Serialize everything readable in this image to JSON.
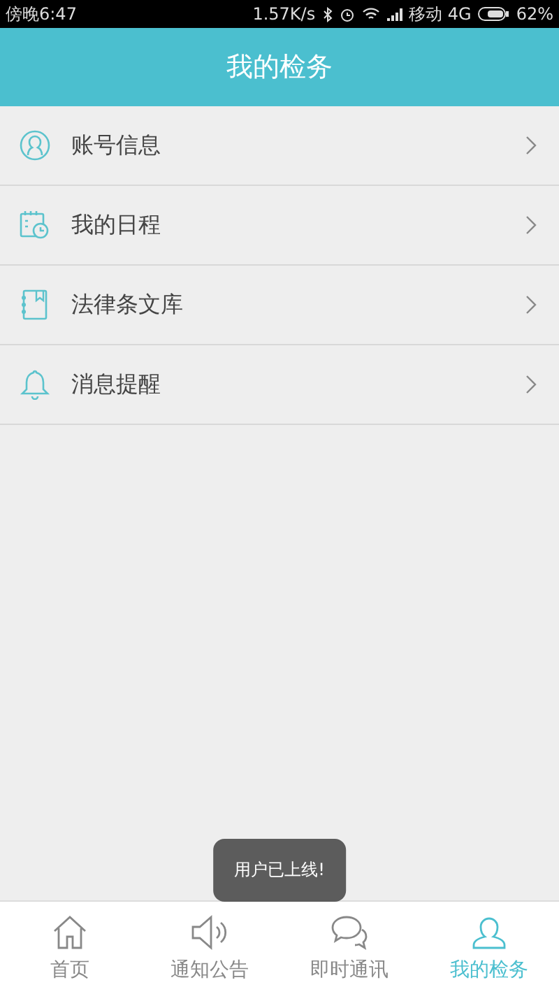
{
  "status_bar": {
    "time": "傍晚6:47",
    "speed": "1.57K/s",
    "carrier": "移动 4G",
    "battery": "62%"
  },
  "header": {
    "title": "我的检务"
  },
  "menu": [
    {
      "kind": "account",
      "label": "账号信息"
    },
    {
      "kind": "schedule",
      "label": "我的日程"
    },
    {
      "kind": "library",
      "label": "法律条文库"
    },
    {
      "kind": "bell",
      "label": "消息提醒"
    }
  ],
  "toast": "用户已上线!",
  "nav": [
    {
      "kind": "home",
      "label": "首页",
      "selected": false
    },
    {
      "kind": "speaker",
      "label": "通知公告",
      "selected": false
    },
    {
      "kind": "chat",
      "label": "即时通讯",
      "selected": false
    },
    {
      "kind": "person",
      "label": "我的检务",
      "selected": true
    }
  ]
}
